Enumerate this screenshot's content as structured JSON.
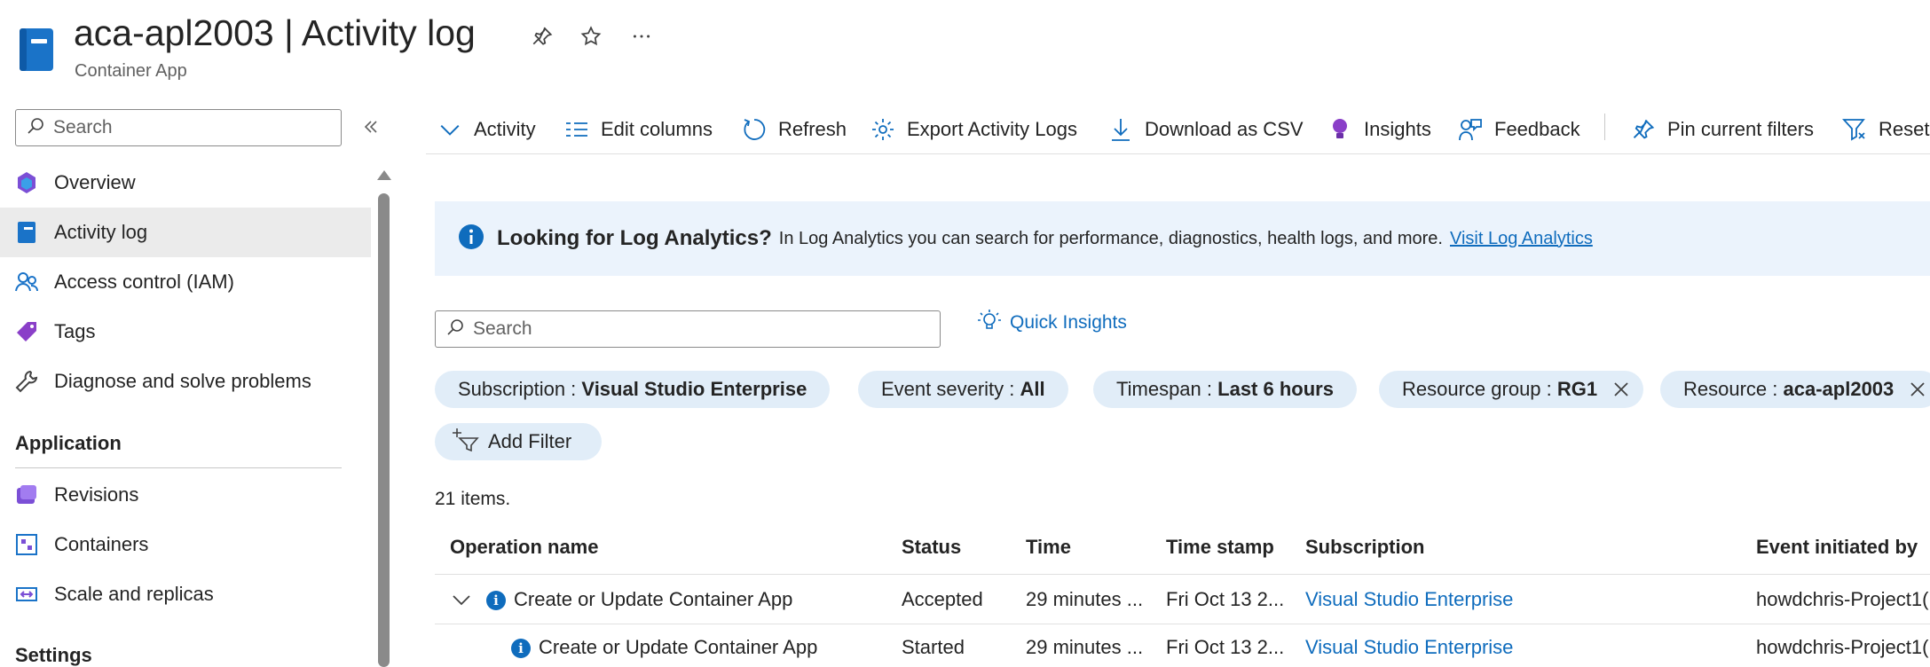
{
  "header": {
    "title": "aca-apl2003 | Activity log",
    "subtitle": "Container App",
    "icons": [
      "pin-icon",
      "star-icon",
      "more-icon"
    ]
  },
  "sidebar": {
    "search_placeholder": "Search",
    "items": [
      {
        "label": "Overview",
        "icon": "overview-icon"
      },
      {
        "label": "Activity log",
        "icon": "activity-log-icon",
        "selected": true
      },
      {
        "label": "Access control (IAM)",
        "icon": "people-icon"
      },
      {
        "label": "Tags",
        "icon": "tag-icon"
      },
      {
        "label": "Diagnose and solve problems",
        "icon": "wrench-icon"
      }
    ],
    "section_application": "Application",
    "application_items": [
      {
        "label": "Revisions",
        "icon": "revisions-icon"
      },
      {
        "label": "Containers",
        "icon": "containers-icon"
      },
      {
        "label": "Scale and replicas",
        "icon": "scale-icon"
      }
    ],
    "section_settings": "Settings"
  },
  "toolbar": {
    "activity": "Activity",
    "edit_columns": "Edit columns",
    "refresh": "Refresh",
    "export": "Export Activity Logs",
    "download": "Download as CSV",
    "insights": "Insights",
    "feedback": "Feedback",
    "pin_filters": "Pin current filters",
    "reset": "Reset"
  },
  "banner": {
    "heading": "Looking for Log Analytics?",
    "text": "In Log Analytics you can search for performance, diagnostics, health logs, and more.",
    "link": "Visit Log Analytics"
  },
  "search": {
    "placeholder": "Search",
    "quick_insights": "Quick Insights"
  },
  "filters": [
    {
      "key": "Subscription : ",
      "value": "Visual Studio Enterprise",
      "removable": false
    },
    {
      "key": "Event severity : ",
      "value": "All",
      "removable": false
    },
    {
      "key": "Timespan : ",
      "value": "Last 6 hours",
      "removable": false
    },
    {
      "key": "Resource group : ",
      "value": "RG1",
      "removable": true
    },
    {
      "key": "Resource : ",
      "value": "aca-apl2003",
      "removable": true
    }
  ],
  "add_filter": "Add Filter",
  "item_count": "21 items.",
  "table": {
    "columns": [
      "Operation name",
      "Status",
      "Time",
      "Time stamp",
      "Subscription",
      "Event initiated by"
    ],
    "rows": [
      {
        "operation": "Create or Update Container App",
        "status": "Accepted",
        "time": "29 minutes ...",
        "timestamp": "Fri Oct 13 2...",
        "subscription": "Visual Studio Enterprise",
        "initiated_by": "howdchris-Project1(",
        "expanded": true
      },
      {
        "operation": "Create or Update Container App",
        "status": "Started",
        "time": "29 minutes ...",
        "timestamp": "Fri Oct 13 2...",
        "subscription": "Visual Studio Enterprise",
        "initiated_by": "howdchris-Project1("
      }
    ]
  },
  "colors": {
    "accent": "#0f6cbd",
    "pill_bg": "#e1edf8",
    "banner_bg": "#ebf3fc",
    "selected_nav_bg": "#ebebeb"
  }
}
